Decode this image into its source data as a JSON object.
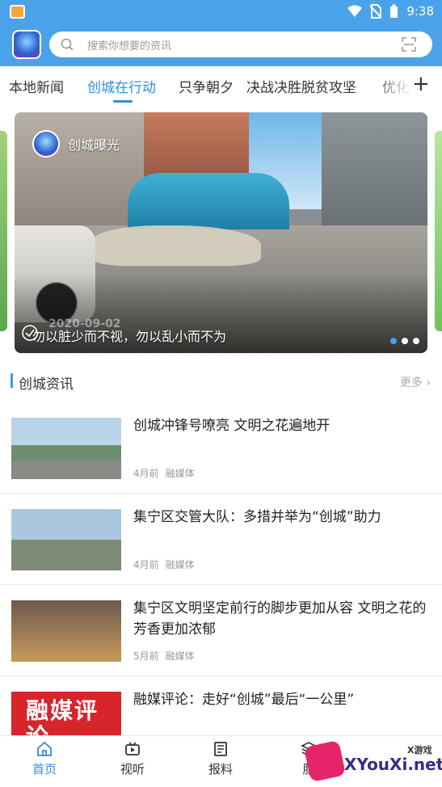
{
  "status_bar": {
    "time": "9:38"
  },
  "search": {
    "placeholder": "搜索你想要的资讯"
  },
  "tabs": [
    {
      "label": "本地新闻",
      "active": false
    },
    {
      "label": "创城在行动",
      "active": true
    },
    {
      "label": "只争朝夕",
      "active": false
    },
    {
      "label": "决战决胜脱贫攻坚",
      "active": false
    },
    {
      "label": "优化",
      "active": false
    }
  ],
  "banner": {
    "channel_name": "创城曝光",
    "date_stamp": "2020-09-02",
    "caption": "勿以脏少而不视，勿以乱小而不为",
    "slides_count": 3,
    "current_slide": 1
  },
  "section": {
    "title": "创城资讯",
    "more_label": "更多"
  },
  "news": [
    {
      "title": "创城冲锋号嘹亮  文明之花遍地开",
      "time": "4月前",
      "source": "融媒体"
    },
    {
      "title": "集宁区交管大队：多措并举为“创城”助力",
      "time": "4月前",
      "source": "融媒体"
    },
    {
      "title": "集宁区文明坚定前行的脚步更加从容  文明之花的芳香更加浓郁",
      "time": "5月前",
      "source": "融媒体"
    },
    {
      "title": "融媒评论：走好“创城”最后“一公里”",
      "time": "",
      "source": "",
      "thumb_text": "融媒评论"
    }
  ],
  "bottom_nav": [
    {
      "label": "首页",
      "icon": "home-icon",
      "active": true
    },
    {
      "label": "视听",
      "icon": "video-icon",
      "active": false
    },
    {
      "label": "报料",
      "icon": "report-icon",
      "active": false
    },
    {
      "label": "服",
      "icon": "service-icon",
      "active": false
    }
  ],
  "watermark": {
    "text": "XYouXi.net",
    "top_text": "X游戏"
  },
  "colors": {
    "primary": "#4aa3ea",
    "accent": "#2e8ee0"
  }
}
